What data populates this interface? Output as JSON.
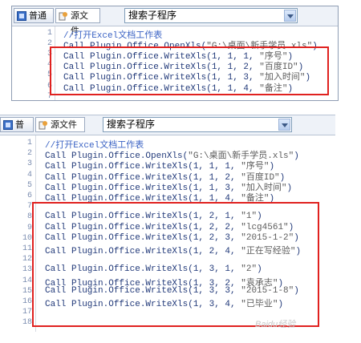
{
  "colors": {
    "highlight": "#e0211f",
    "code": "#223a7a",
    "comment": "#3b63c4",
    "string": "#5c5c5c",
    "line_number": "#7b8db0"
  },
  "panel1": {
    "tabs": [
      {
        "label": "普通",
        "icon": "list-view-icon"
      },
      {
        "label": "源文件",
        "icon": "source-file-icon"
      }
    ],
    "dropdown": "搜索子程序",
    "lines": [
      {
        "n": "1",
        "text": "//打开Excel文档工作表",
        "comment": true
      },
      {
        "n": "2",
        "pre": "Call Plugin.Office.OpenXls(",
        "str": "\"G:\\桌面\\新手学员.xls\"",
        "post": ")"
      },
      {
        "n": "3",
        "pre": "Call Plugin.Office.WriteXls(1, 1, 1, ",
        "str": "\"序号\"",
        "post": ")"
      },
      {
        "n": "4",
        "pre": "Call Plugin.Office.WriteXls(1, 1, 2, ",
        "str": "\"百度ID\"",
        "post": ")"
      },
      {
        "n": "5",
        "pre": "Call Plugin.Office.WriteXls(1, 1, 3, ",
        "str": "\"加入时间\"",
        "post": ")"
      },
      {
        "n": "6",
        "pre": "Call Plugin.Office.WriteXls(1, 1, 4, ",
        "str": "\"备注\"",
        "post": ")"
      },
      {
        "n": "7",
        "pre": ""
      }
    ]
  },
  "panel2": {
    "tabs": [
      {
        "label": "普通",
        "icon": "list-view-icon"
      },
      {
        "label": "源文件",
        "icon": "source-file-icon"
      }
    ],
    "dropdown": "搜索子程序",
    "lines": [
      {
        "n": "1",
        "text": "//打开Excel文档工作表",
        "comment": true
      },
      {
        "n": "2",
        "pre": "Call Plugin.Office.OpenXls(",
        "str": "\"G:\\桌面\\新手学员.xls\"",
        "post": ")"
      },
      {
        "n": "3",
        "pre": "Call Plugin.Office.WriteXls(1, 1, 1, ",
        "str": "\"序号\"",
        "post": ")"
      },
      {
        "n": "4",
        "pre": "Call Plugin.Office.WriteXls(1, 1, 2, ",
        "str": "\"百度ID\"",
        "post": ")"
      },
      {
        "n": "5",
        "pre": "Call Plugin.Office.WriteXls(1, 1, 3, ",
        "str": "\"加入时间\"",
        "post": ")"
      },
      {
        "n": "6",
        "pre": "Call Plugin.Office.WriteXls(1, 1, 4, ",
        "str": "\"备注\"",
        "post": ")"
      },
      {
        "n": "7",
        "pre": ""
      },
      {
        "n": "8",
        "pre": "Call Plugin.Office.WriteXls(1, 2, 1, ",
        "str": "\"1\"",
        "post": ")"
      },
      {
        "n": "9",
        "pre": "Call Plugin.Office.WriteXls(1, 2, 2, ",
        "str": "\"lcg4561\"",
        "post": ")"
      },
      {
        "n": "10",
        "pre": "Call Plugin.Office.WriteXls(1, 2, 3, ",
        "str": "\"2015-1-2\"",
        "post": ")"
      },
      {
        "n": "11",
        "pre": "Call Plugin.Office.WriteXls(1, 2, 4, ",
        "str": "\"正在写经验\"",
        "post": ")"
      },
      {
        "n": "12",
        "pre": ""
      },
      {
        "n": "13",
        "pre": "Call Plugin.Office.WriteXls(1, 3, 1, ",
        "str": "\"2\"",
        "post": ")"
      },
      {
        "n": "14",
        "pre": "Call Plugin.Office.WriteXls(1, 3, 2, ",
        "str": "\"袁承志\"",
        "post": ")"
      },
      {
        "n": "15",
        "pre": "Call Plugin.Office.WriteXls(1, 3, 3, ",
        "str": "\"2015-1-8\"",
        "post": ")"
      },
      {
        "n": "16",
        "pre": "Call Plugin.Office.WriteXls(1, 3, 4, ",
        "str": "\"已毕业\"",
        "post": ")"
      },
      {
        "n": "17",
        "pre": ""
      },
      {
        "n": "18",
        "pre": ""
      }
    ]
  },
  "watermark": "Baidu经验"
}
